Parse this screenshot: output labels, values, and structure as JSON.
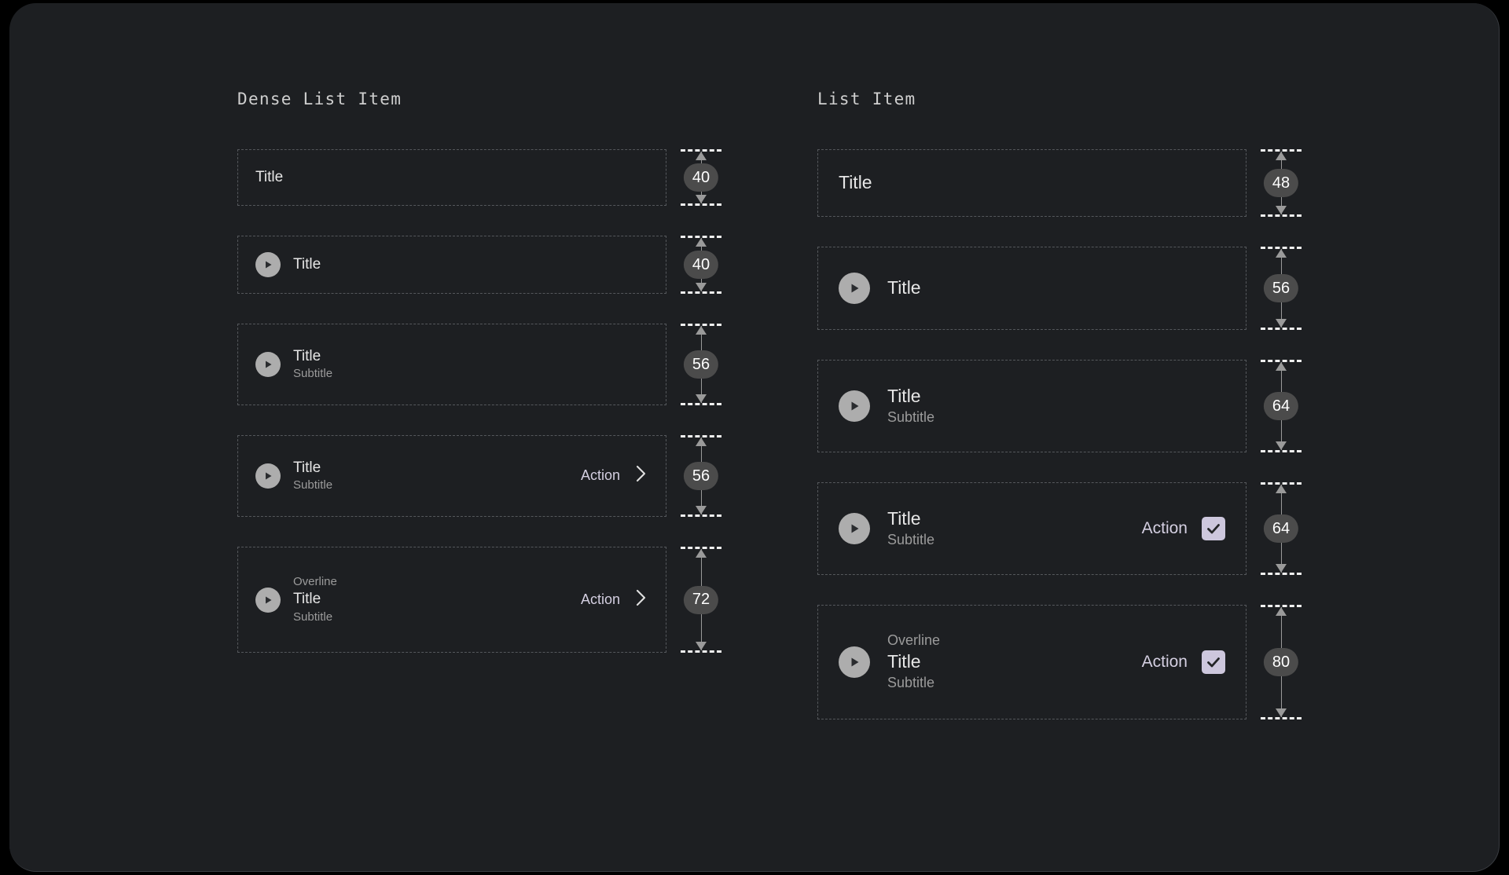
{
  "theme": {
    "page_background": "#000000",
    "surface_background": "#1d1f22",
    "title_color": "#e6e6e6",
    "secondary_text_color": "#9b9b9b",
    "accent_color": "#cdc7dd",
    "badge_background": "#4b4b4b",
    "avatar_background": "#adadad",
    "dashed_border_color": "#55585c"
  },
  "columns": [
    {
      "heading": "Dense List Item",
      "rows": [
        {
          "height_label": "40",
          "has_avatar": false,
          "overline": null,
          "title": "Title",
          "subtitle": null,
          "action_label": null,
          "trailing_icon": null
        },
        {
          "height_label": "40",
          "has_avatar": true,
          "overline": null,
          "title": "Title",
          "subtitle": null,
          "action_label": null,
          "trailing_icon": null
        },
        {
          "height_label": "56",
          "has_avatar": true,
          "overline": null,
          "title": "Title",
          "subtitle": "Subtitle",
          "action_label": null,
          "trailing_icon": null
        },
        {
          "height_label": "56",
          "has_avatar": true,
          "overline": null,
          "title": "Title",
          "subtitle": "Subtitle",
          "action_label": "Action",
          "trailing_icon": "chevron-right-icon"
        },
        {
          "height_label": "72",
          "has_avatar": true,
          "overline": "Overline",
          "title": "Title",
          "subtitle": "Subtitle",
          "action_label": "Action",
          "trailing_icon": "chevron-right-icon"
        }
      ]
    },
    {
      "heading": "List Item",
      "rows": [
        {
          "height_label": "48",
          "has_avatar": false,
          "overline": null,
          "title": "Title",
          "subtitle": null,
          "action_label": null,
          "trailing_icon": null
        },
        {
          "height_label": "56",
          "has_avatar": true,
          "overline": null,
          "title": "Title",
          "subtitle": null,
          "action_label": null,
          "trailing_icon": null
        },
        {
          "height_label": "64",
          "has_avatar": true,
          "overline": null,
          "title": "Title",
          "subtitle": "Subtitle",
          "action_label": null,
          "trailing_icon": null
        },
        {
          "height_label": "64",
          "has_avatar": true,
          "overline": null,
          "title": "Title",
          "subtitle": "Subtitle",
          "action_label": "Action",
          "trailing_icon": "checkbox-checked-icon"
        },
        {
          "height_label": "80",
          "has_avatar": true,
          "overline": "Overline",
          "title": "Title",
          "subtitle": "Subtitle",
          "action_label": "Action",
          "trailing_icon": "checkbox-checked-icon"
        }
      ]
    }
  ]
}
